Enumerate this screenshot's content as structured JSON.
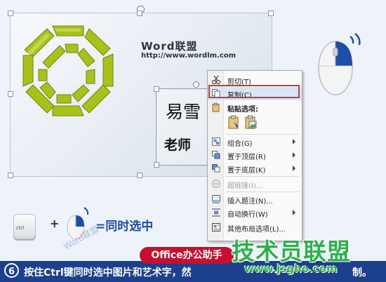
{
  "image_card": {
    "logo_text": "Word联盟",
    "logo_url": "http://www.wordlm.com",
    "textbox_name": "易雪",
    "textbox_title": "老师"
  },
  "context_menu": {
    "items": [
      {
        "label": "剪切(T)",
        "icon": "scissors-icon",
        "submenu": false,
        "disabled": false
      },
      {
        "label": "复制(C)",
        "icon": "copy-icon",
        "submenu": false,
        "disabled": false,
        "highlighted": true
      },
      {
        "label": "粘贴选项:",
        "icon": "paste-icon",
        "submenu": false,
        "disabled": false
      },
      {
        "label": "组合(G)",
        "icon": "group-icon",
        "submenu": true,
        "disabled": false
      },
      {
        "label": "置于顶层(R)",
        "icon": "bring-front-icon",
        "submenu": true,
        "disabled": false
      },
      {
        "label": "置于底层(K)",
        "icon": "send-back-icon",
        "submenu": true,
        "disabled": false
      },
      {
        "label": "超链接(I)...",
        "icon": "hyperlink-icon",
        "submenu": false,
        "disabled": true
      },
      {
        "label": "插入题注(N)...",
        "icon": "caption-icon",
        "submenu": false,
        "disabled": false
      },
      {
        "label": "自动换行(W)",
        "icon": "wrap-icon",
        "submenu": true,
        "disabled": false
      },
      {
        "label": "其他布局选项(L)...",
        "icon": "layout-icon",
        "submenu": false,
        "disabled": false
      }
    ]
  },
  "hint": {
    "ctrl_label": "ctrl",
    "plus": "+",
    "text": "=同时选中"
  },
  "step": {
    "number": "6",
    "text": "按住Ctrl键同时选中图片和艺术字，然",
    "text_end": "制。"
  },
  "watermarks": {
    "office": "Office办公助手",
    "jishu": "技术员联盟",
    "url": "www.jsgho.com",
    "word": "Word联盟"
  },
  "colors": {
    "highlight_box": "#d23838",
    "bottom_bar": "#1c3f8e",
    "hint_text": "#1d4ea8"
  }
}
